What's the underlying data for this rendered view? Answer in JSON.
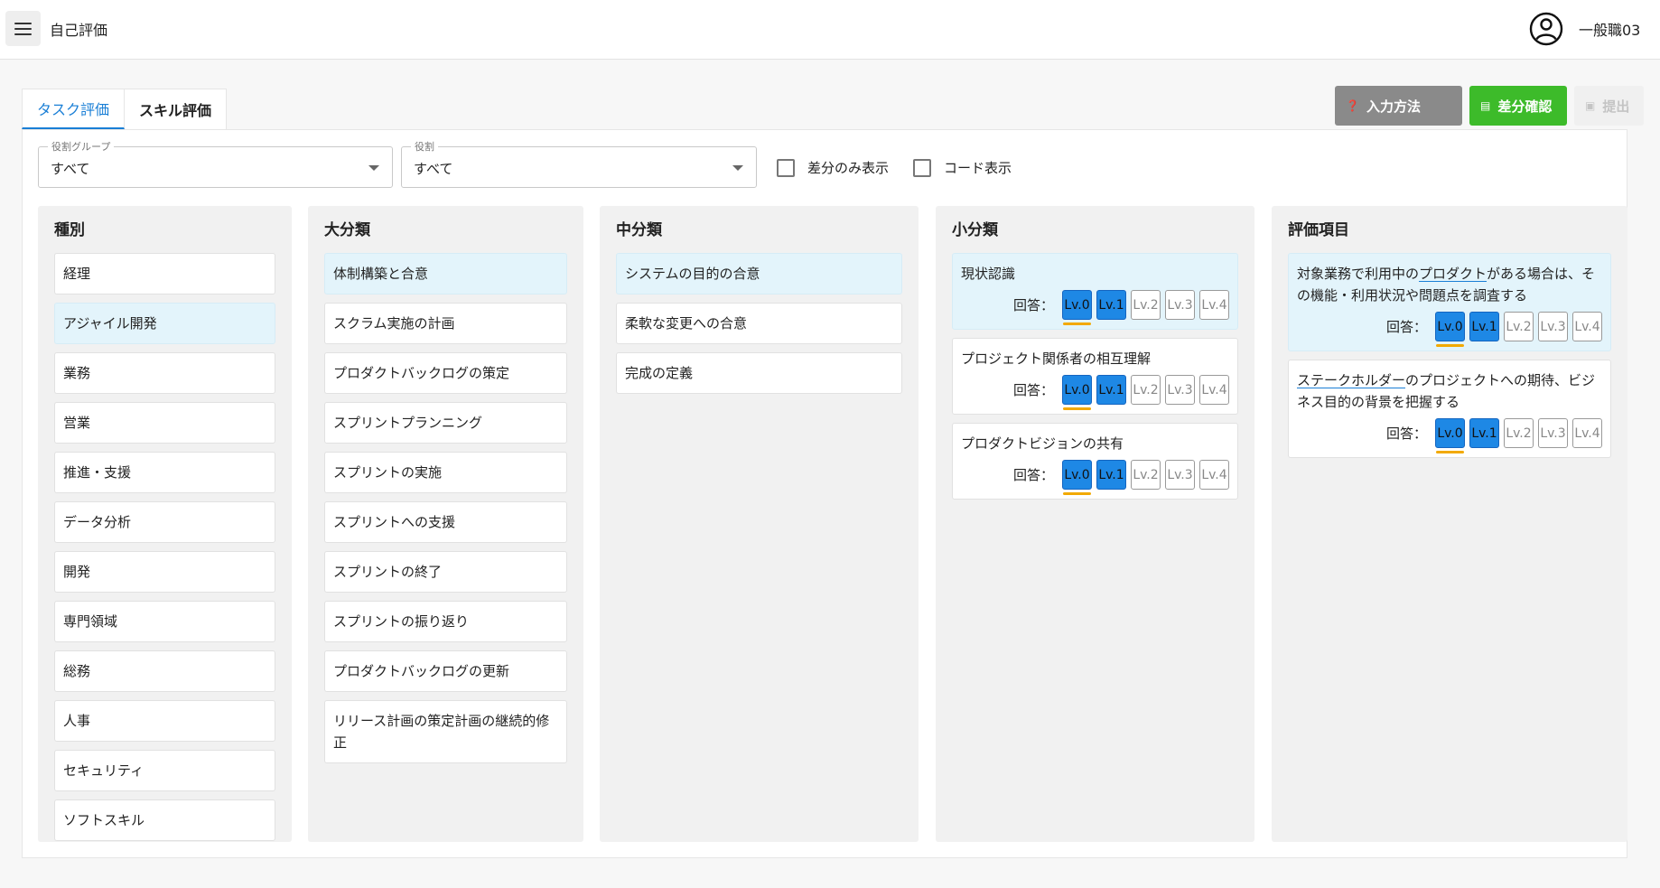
{
  "header": {
    "title": "自己評価",
    "user_name": "一般職03"
  },
  "tabs": [
    {
      "label": "タスク評価",
      "active": true
    },
    {
      "label": "スキル評価",
      "active": false
    }
  ],
  "actions": {
    "help_label": "入力方法",
    "diff_label": "差分確認",
    "submit_label": "提出"
  },
  "filters": {
    "role_group": {
      "label": "役割グループ",
      "value": "すべて"
    },
    "role": {
      "label": "役割",
      "value": "すべて"
    },
    "diff_only_label": "差分のみ表示",
    "code_label": "コード表示"
  },
  "columns": {
    "type": {
      "title": "種別",
      "items": [
        "経理",
        "アジャイル開発",
        "業務",
        "営業",
        "推進・支援",
        "データ分析",
        "開発",
        "専門領域",
        "総務",
        "人事",
        "セキュリティ",
        "ソフトスキル"
      ]
    },
    "major": {
      "title": "大分類",
      "items": [
        "体制構築と合意",
        "スクラム実施の計画",
        "プロダクトバックログの策定",
        "スプリントプランニング",
        "スプリントの実施",
        "スプリントへの支援",
        "スプリントの終了",
        "スプリントの振り返り",
        "プロダクトバックログの更新",
        "リリース計画の策定計画の継続的修正"
      ]
    },
    "middle": {
      "title": "中分類",
      "items": [
        "システムの目的の合意",
        "柔軟な変更への合意",
        "完成の定義"
      ]
    },
    "minor": {
      "title": "小分類",
      "items": [
        "現状認識",
        "プロジェクト関係者の相互理解",
        "プロダクトビジョンの共有"
      ]
    },
    "eval": {
      "title": "評価項目",
      "items": [
        {
          "pre": "対象業務で利用中の",
          "link": "プロダクト",
          "post": "がある場合は、その機能・利用状況や問題点を調査する"
        },
        {
          "pre": "",
          "link": "ステークホルダー",
          "post": "のプロジェクトへの期待、ビジネス目的の背景を把握する"
        }
      ]
    }
  },
  "answer_label": "回答：",
  "levels": [
    "Lv.0",
    "Lv.1",
    "Lv.2",
    "Lv.3",
    "Lv.4"
  ],
  "colors": {
    "accent": "#1a7fd6",
    "level_on": "#1e88e5",
    "current_marker": "#f2a900",
    "diff_button": "#3dbb2a"
  }
}
